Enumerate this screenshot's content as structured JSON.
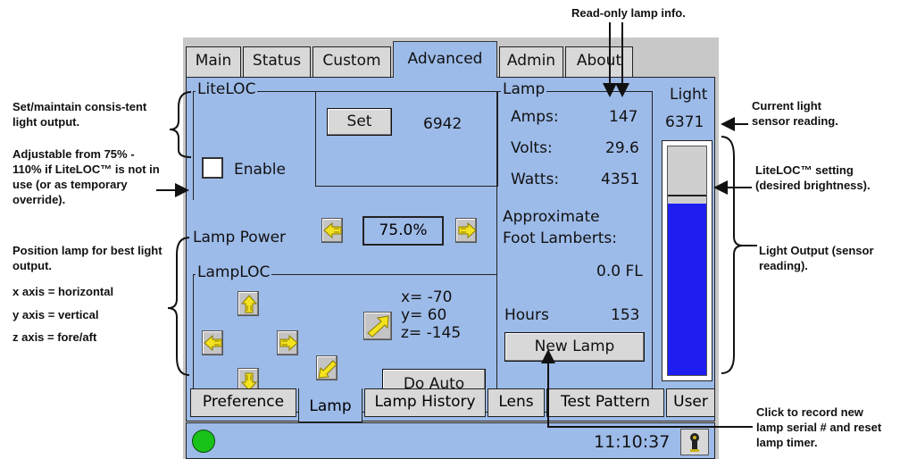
{
  "top_tabs": [
    "Main",
    "Status",
    "Custom",
    "Advanced",
    "Admin",
    "About"
  ],
  "active_top_tab": "Advanced",
  "liteloc": {
    "title": "LiteLOC",
    "enable_label": "Enable",
    "enabled": false,
    "set_label": "Set",
    "set_value": "6942",
    "lamp_power_label": "Lamp Power",
    "lamp_power_value": "75.0%"
  },
  "lamploc": {
    "title": "LampLOC",
    "x": "x= -70",
    "y": "y= 60",
    "z": "z= -145",
    "do_auto_label": "Do Auto"
  },
  "lamp": {
    "title": "Lamp",
    "amps_label": "Amps:",
    "amps_value": "147",
    "volts_label": "Volts:",
    "volts_value": "29.6",
    "watts_label": "Watts:",
    "watts_value": "4351",
    "fl_label_1": "Approximate",
    "fl_label_2": "Foot Lamberts:",
    "fl_value": "0.0 FL",
    "hours_label": "Hours",
    "hours_value": "153",
    "new_lamp_label": "New Lamp"
  },
  "light": {
    "title": "Light",
    "value": "6371",
    "output_fraction": 0.75,
    "setpoint_fraction": 0.78,
    "bar_color": "#1e1ef0"
  },
  "bottom_tabs": [
    "Preference",
    "Lamp",
    "Lamp History",
    "Lens",
    "Test Pattern",
    "User"
  ],
  "active_bottom_tab": "Lamp",
  "status": {
    "time": "11:10:37",
    "led_color": "#19c219"
  },
  "annotations": {
    "readonly": "Read-only lamp info.",
    "current_sensor": "Current light sensor reading.",
    "set_maintain": "Set/maintain consis-tent light output.",
    "adjustable": "Adjustable from 75% - 110% if LiteLOC™ is not in use (or as temporary override).",
    "liteloc_setting": "LiteLOC™ setting (desired brightness).",
    "position_lamp": "Position lamp for best light output.",
    "x_axis": "x axis = horizontal",
    "y_axis": "y axis = vertical",
    "z_axis": "z axis = fore/aft",
    "light_output": "Light Output (sensor reading).",
    "click_record": "Click to record new lamp serial # and reset lamp timer."
  }
}
